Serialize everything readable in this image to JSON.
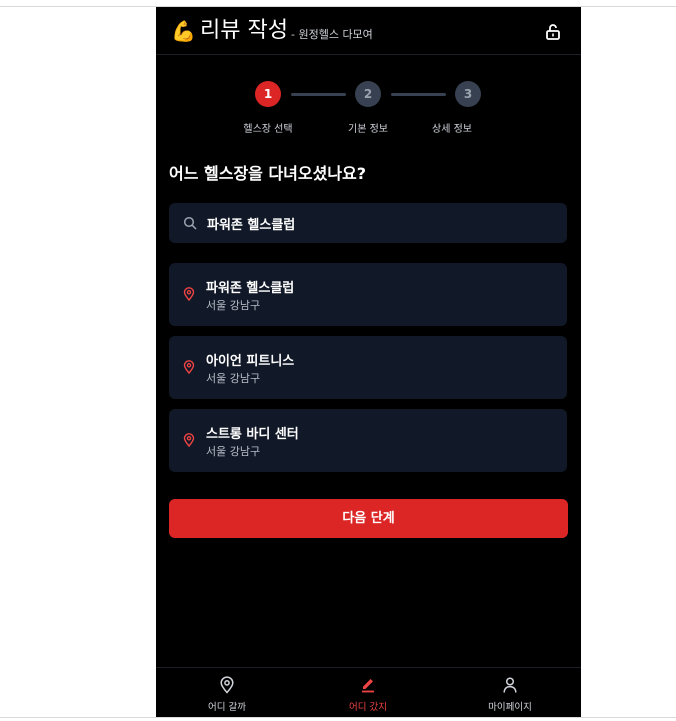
{
  "header": {
    "emoji": "💪",
    "title": "리뷰 작성",
    "subtitle": "- 원정헬스 다모여"
  },
  "steps": [
    {
      "number": "1",
      "label": "헬스장 선택",
      "active": true
    },
    {
      "number": "2",
      "label": "기본 정보",
      "active": false
    },
    {
      "number": "3",
      "label": "상세 정보",
      "active": false
    }
  ],
  "question": "어느 헬스장을 다녀오셨나요?",
  "search": {
    "value": "파워존 헬스클럽",
    "placeholder": ""
  },
  "gyms": [
    {
      "name": "파워존 헬스클럽",
      "location": "서울 강남구"
    },
    {
      "name": "아이언 피트니스",
      "location": "서울 강남구"
    },
    {
      "name": "스트롱 바디 센터",
      "location": "서울 강남구"
    }
  ],
  "next_button": "다음 단계",
  "nav": [
    {
      "label": "어디 갈까",
      "icon": "map-pin-icon"
    },
    {
      "label": "어디 갔지",
      "icon": "pencil-icon"
    },
    {
      "label": "마이페이지",
      "icon": "user-icon"
    }
  ],
  "colors": {
    "accent": "#dc2626",
    "card": "#111827",
    "inactive_step": "#374151",
    "background": "#000000"
  }
}
